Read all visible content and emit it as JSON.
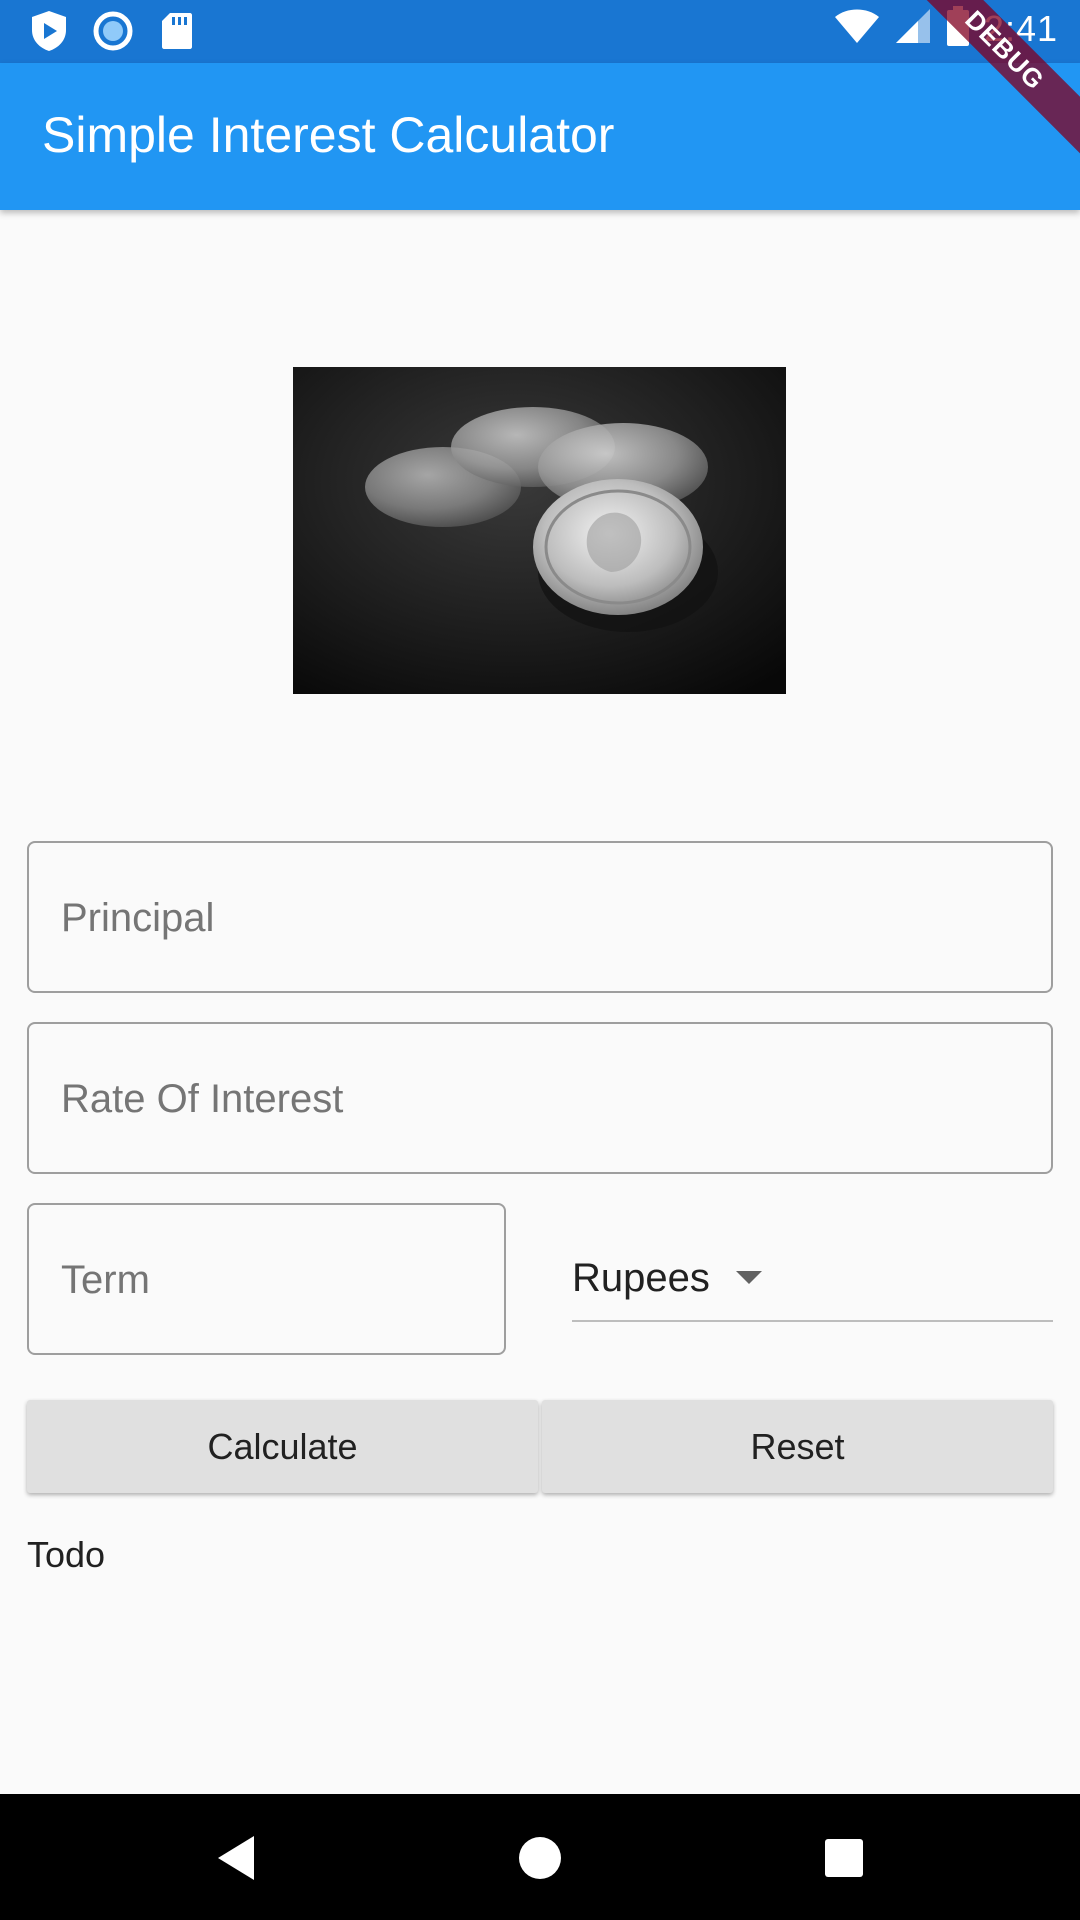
{
  "status_bar": {
    "time": "2:41",
    "left_icons": [
      "play-protect-icon",
      "circle-notification-icon",
      "sd-card-icon"
    ],
    "right_icons": [
      "wifi-icon",
      "cell-signal-icon",
      "battery-icon"
    ]
  },
  "app_bar": {
    "title": "Simple Interest Calculator",
    "debug_banner": "DEBUG",
    "color": "#2196f3",
    "status_color": "#1976d2"
  },
  "form": {
    "principal_placeholder": "Principal",
    "rate_placeholder": "Rate Of Interest",
    "term_placeholder": "Term",
    "currency": {
      "selected": "Rupees"
    },
    "calculate_label": "Calculate",
    "reset_label": "Reset",
    "result_text": "Todo"
  },
  "nav_bar": {
    "icons": [
      "back-icon",
      "home-icon",
      "recents-icon"
    ]
  }
}
